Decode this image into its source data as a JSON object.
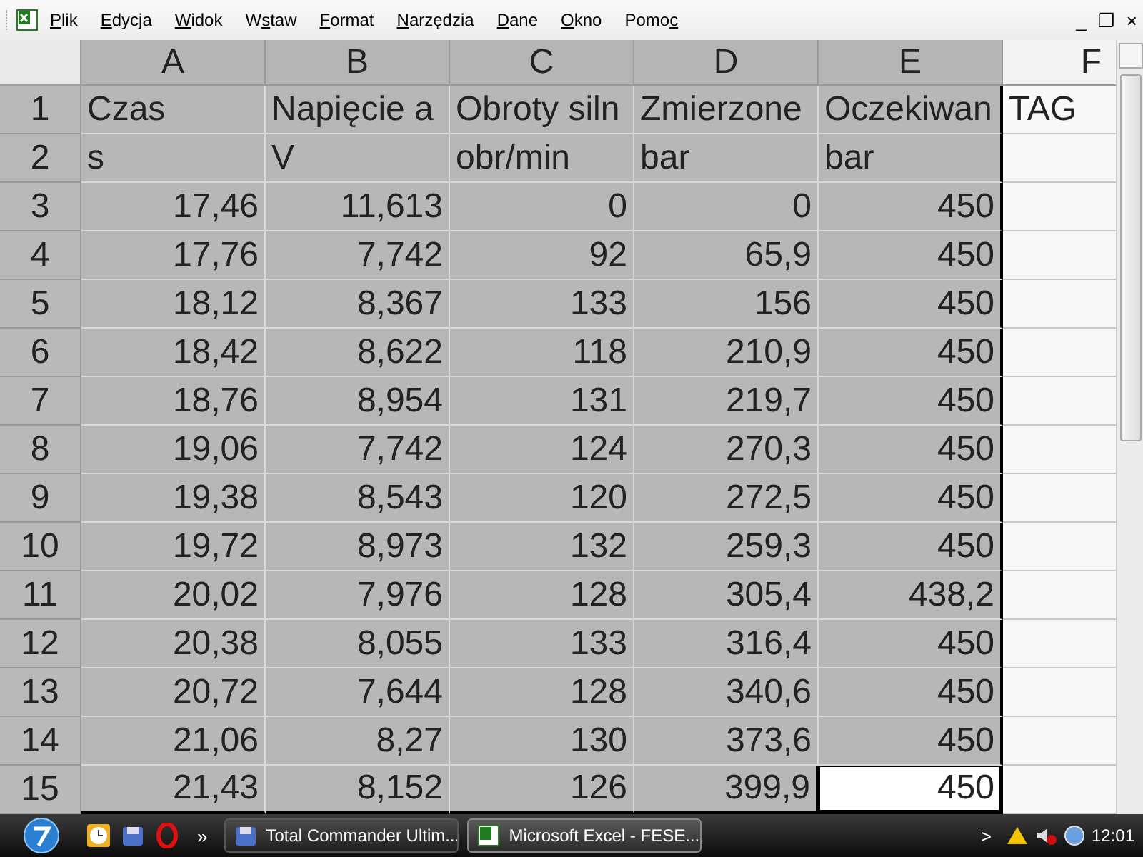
{
  "menu_bar": {
    "items": [
      {
        "key": "P",
        "after": "lik"
      },
      {
        "key": "E",
        "after": "dycja"
      },
      {
        "key": "W",
        "after": "idok"
      },
      {
        "before": "W",
        "key": "s",
        "after": "taw"
      },
      {
        "key": "F",
        "after": "ormat"
      },
      {
        "key": "N",
        "after": "arzędzia"
      },
      {
        "key": "D",
        "after": "ane"
      },
      {
        "key": "O",
        "after": "kno"
      },
      {
        "before": "Pomo",
        "key": "c"
      }
    ],
    "window_controls": [
      "_",
      "❐",
      "×"
    ]
  },
  "sheet": {
    "columns": [
      {
        "label": "A",
        "selected": true
      },
      {
        "label": "B",
        "selected": true
      },
      {
        "label": "C",
        "selected": true
      },
      {
        "label": "D",
        "selected": true
      },
      {
        "label": "E",
        "selected": true
      },
      {
        "label": "F",
        "selected": false
      }
    ],
    "rows": [
      {
        "header": "1",
        "kind": "text",
        "cells": [
          {
            "text": "Czas",
            "selected": true
          },
          {
            "text": "Napięcie a",
            "selected": true
          },
          {
            "text": "Obroty siln",
            "selected": true
          },
          {
            "text": "Zmierzone",
            "selected": true
          },
          {
            "text": "Oczekiwan",
            "selected": true
          },
          {
            "text": "TAG",
            "selected": false
          }
        ]
      },
      {
        "header": "2",
        "kind": "text",
        "cells": [
          {
            "text": "s",
            "selected": true
          },
          {
            "text": "V",
            "selected": true
          },
          {
            "text": "obr/min",
            "selected": true
          },
          {
            "text": "bar",
            "selected": true
          },
          {
            "text": "bar",
            "selected": true
          }
        ]
      },
      {
        "header": "3",
        "kind": "number",
        "cells": [
          {
            "text": "17,46",
            "selected": true
          },
          {
            "text": "11,613",
            "selected": true
          },
          {
            "text": "0",
            "selected": true
          },
          {
            "text": "0",
            "selected": true
          },
          {
            "text": "450",
            "selected": true
          }
        ]
      },
      {
        "header": "4",
        "kind": "number",
        "cells": [
          {
            "text": "17,76",
            "selected": true
          },
          {
            "text": "7,742",
            "selected": true
          },
          {
            "text": "92",
            "selected": true
          },
          {
            "text": "65,9",
            "selected": true
          },
          {
            "text": "450",
            "selected": true
          }
        ]
      },
      {
        "header": "5",
        "kind": "number",
        "cells": [
          {
            "text": "18,12",
            "selected": true
          },
          {
            "text": "8,367",
            "selected": true
          },
          {
            "text": "133",
            "selected": true
          },
          {
            "text": "156",
            "selected": true
          },
          {
            "text": "450",
            "selected": true
          }
        ]
      },
      {
        "header": "6",
        "kind": "number",
        "cells": [
          {
            "text": "18,42",
            "selected": true
          },
          {
            "text": "8,622",
            "selected": true
          },
          {
            "text": "118",
            "selected": true
          },
          {
            "text": "210,9",
            "selected": true
          },
          {
            "text": "450",
            "selected": true
          }
        ]
      },
      {
        "header": "7",
        "kind": "number",
        "cells": [
          {
            "text": "18,76",
            "selected": true
          },
          {
            "text": "8,954",
            "selected": true
          },
          {
            "text": "131",
            "selected": true
          },
          {
            "text": "219,7",
            "selected": true
          },
          {
            "text": "450",
            "selected": true
          }
        ]
      },
      {
        "header": "8",
        "kind": "number",
        "cells": [
          {
            "text": "19,06",
            "selected": true
          },
          {
            "text": "7,742",
            "selected": true
          },
          {
            "text": "124",
            "selected": true
          },
          {
            "text": "270,3",
            "selected": true
          },
          {
            "text": "450",
            "selected": true
          }
        ]
      },
      {
        "header": "9",
        "kind": "number",
        "cells": [
          {
            "text": "19,38",
            "selected": true
          },
          {
            "text": "8,543",
            "selected": true
          },
          {
            "text": "120",
            "selected": true
          },
          {
            "text": "272,5",
            "selected": true
          },
          {
            "text": "450",
            "selected": true
          }
        ]
      },
      {
        "header": "10",
        "kind": "number",
        "cells": [
          {
            "text": "19,72",
            "selected": true
          },
          {
            "text": "8,973",
            "selected": true
          },
          {
            "text": "132",
            "selected": true
          },
          {
            "text": "259,3",
            "selected": true
          },
          {
            "text": "450",
            "selected": true
          }
        ]
      },
      {
        "header": "11",
        "kind": "number",
        "cells": [
          {
            "text": "20,02",
            "selected": true
          },
          {
            "text": "7,976",
            "selected": true
          },
          {
            "text": "128",
            "selected": true
          },
          {
            "text": "305,4",
            "selected": true
          },
          {
            "text": "438,2",
            "selected": true
          }
        ]
      },
      {
        "header": "12",
        "kind": "number",
        "cells": [
          {
            "text": "20,38",
            "selected": true
          },
          {
            "text": "8,055",
            "selected": true
          },
          {
            "text": "133",
            "selected": true
          },
          {
            "text": "316,4",
            "selected": true
          },
          {
            "text": "450",
            "selected": true
          }
        ]
      },
      {
        "header": "13",
        "kind": "number",
        "cells": [
          {
            "text": "20,72",
            "selected": true
          },
          {
            "text": "7,644",
            "selected": true
          },
          {
            "text": "128",
            "selected": true
          },
          {
            "text": "340,6",
            "selected": true
          },
          {
            "text": "450",
            "selected": true
          }
        ]
      },
      {
        "header": "14",
        "kind": "number",
        "cells": [
          {
            "text": "21,06",
            "selected": true
          },
          {
            "text": "8,27",
            "selected": true
          },
          {
            "text": "130",
            "selected": true
          },
          {
            "text": "373,6",
            "selected": true
          },
          {
            "text": "450",
            "selected": true
          }
        ]
      },
      {
        "header": "15",
        "kind": "number",
        "cells": [
          {
            "text": "21,43",
            "selected": true
          },
          {
            "text": "8,152",
            "selected": true
          },
          {
            "text": "126",
            "selected": true
          },
          {
            "text": "399,9",
            "selected": true
          },
          {
            "text": "450",
            "selected": false
          }
        ]
      }
    ]
  },
  "taskbar": {
    "quick_launch_more": "»",
    "tasks": [
      {
        "label": "Total Commander Ultim...",
        "selected": false,
        "kind": "commander"
      },
      {
        "label": "Microsoft Excel - FESE...",
        "selected": true,
        "kind": "excel"
      }
    ],
    "tray_expand": ">",
    "clock": "12:01"
  }
}
